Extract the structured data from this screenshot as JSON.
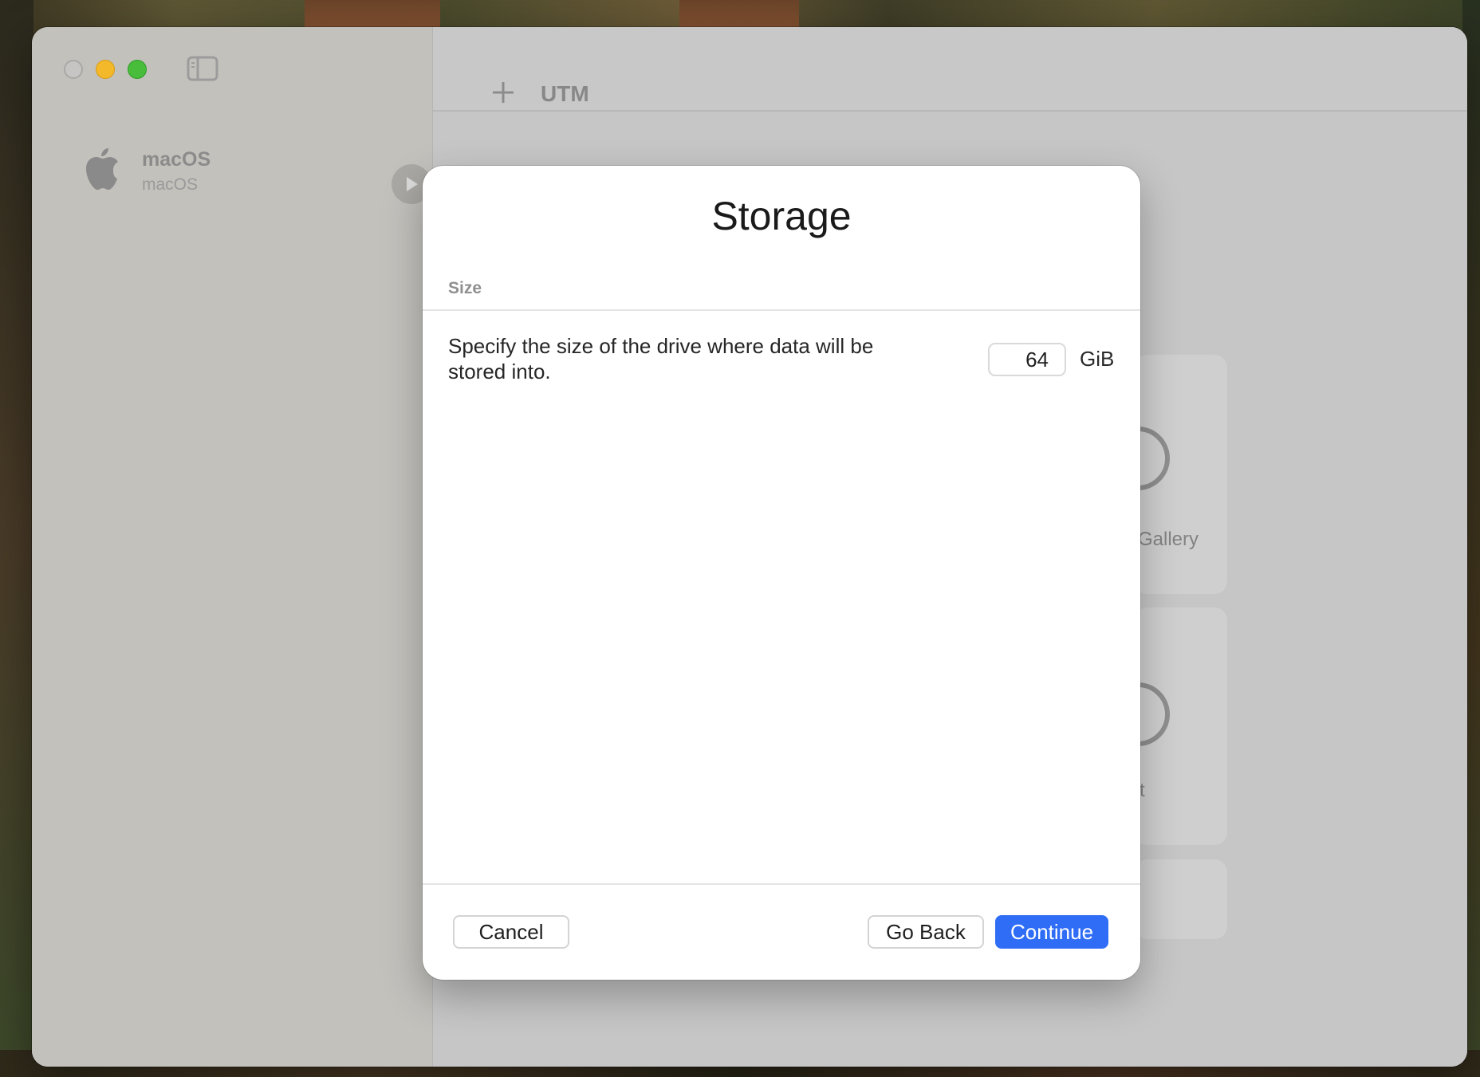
{
  "window": {
    "app_title": "UTM",
    "traffic_lights": {
      "close_color": "#c6c5c3",
      "minimize_color": "#f4b82b",
      "maximize_color": "#48bd3c"
    }
  },
  "sidebar": {
    "vm": {
      "name": "macOS",
      "os": "macOS",
      "icon": "apple-logo-icon"
    }
  },
  "main_cards": {
    "gallery_label": "Gallery",
    "second_label": "t"
  },
  "dialog": {
    "title": "Storage",
    "section": "Size",
    "description": "Specify the size of the drive where data will be stored into.",
    "size_value": "64",
    "unit": "GiB",
    "buttons": {
      "cancel": "Cancel",
      "go_back": "Go Back",
      "continue": "Continue"
    },
    "accent_color": "#2f6df6"
  }
}
